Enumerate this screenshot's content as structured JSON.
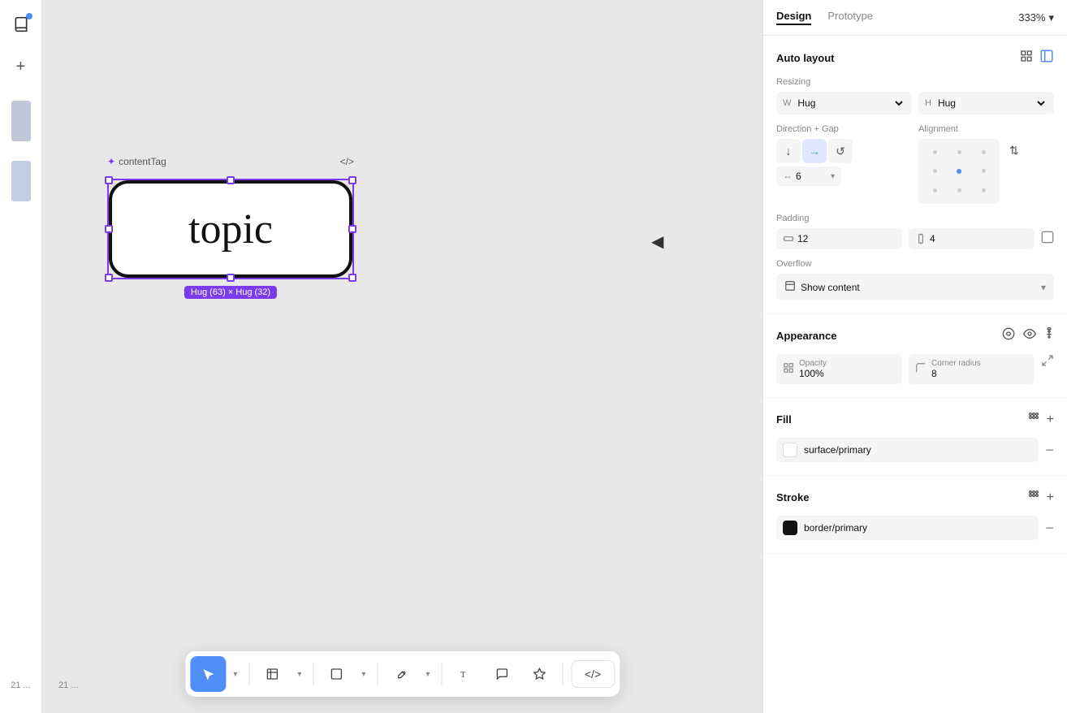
{
  "leftSidebar": {
    "icons": [
      {
        "name": "book-icon",
        "symbol": "📖",
        "hasBadge": true
      },
      {
        "name": "plus-icon",
        "symbol": "+"
      }
    ],
    "panels": [
      "panel1",
      "panel2"
    ],
    "pageNumber": "21 ..."
  },
  "canvas": {
    "componentLabel": "contentTag",
    "componentLabelIcon": "✦",
    "codeIcon": "</>",
    "topicText": "topic",
    "sizeLabel": "Hug (63) × Hug (32)",
    "cursorSymbol": "▶"
  },
  "toolbar": {
    "buttons": [
      {
        "name": "select-tool",
        "symbol": "↖",
        "active": true
      },
      {
        "name": "select-dropdown",
        "symbol": "▾",
        "active": false
      },
      {
        "name": "frame-tool",
        "symbol": "⊞",
        "active": false
      },
      {
        "name": "frame-dropdown",
        "symbol": "▾",
        "active": false
      },
      {
        "name": "shape-tool",
        "symbol": "□",
        "active": false
      },
      {
        "name": "shape-dropdown",
        "symbol": "▾",
        "active": false
      },
      {
        "name": "pen-tool",
        "symbol": "✒",
        "active": false
      },
      {
        "name": "pen-dropdown",
        "symbol": "▾",
        "active": false
      },
      {
        "name": "text-tool",
        "symbol": "T",
        "active": false
      },
      {
        "name": "comment-tool",
        "symbol": "💬",
        "active": false
      },
      {
        "name": "plugin-tool",
        "symbol": "✳",
        "active": false
      }
    ],
    "codeButton": {
      "label": "</>"
    }
  },
  "rightPanel": {
    "tabs": {
      "design": "Design",
      "prototype": "Prototype"
    },
    "zoom": "333%",
    "autoLayout": {
      "title": "Auto layout",
      "icons": [
        "grid-icon",
        "layout-icon"
      ]
    },
    "resizing": {
      "title": "Resizing",
      "widthLabel": "W",
      "widthValue": "Hug",
      "heightLabel": "H",
      "heightValue": "Hug"
    },
    "directionGap": {
      "title": "Direction + Gap",
      "buttons": [
        "down-btn",
        "right-btn",
        "rotate-btn"
      ],
      "gapValue": "6"
    },
    "alignment": {
      "title": "Alignment"
    },
    "padding": {
      "title": "Padding",
      "horizontalValue": "12",
      "verticalValue": "4"
    },
    "overflow": {
      "title": "Overflow",
      "value": "Show content"
    },
    "appearance": {
      "title": "Appearance",
      "opacity": {
        "label": "Opacity",
        "value": "100%"
      },
      "cornerRadius": {
        "label": "Corner radius",
        "value": "8"
      }
    },
    "fill": {
      "title": "Fill",
      "colorName": "surface/primary",
      "colorValue": "#ffffff"
    },
    "stroke": {
      "title": "Stroke",
      "colorName": "border/primary",
      "colorValue": "#111111"
    }
  }
}
